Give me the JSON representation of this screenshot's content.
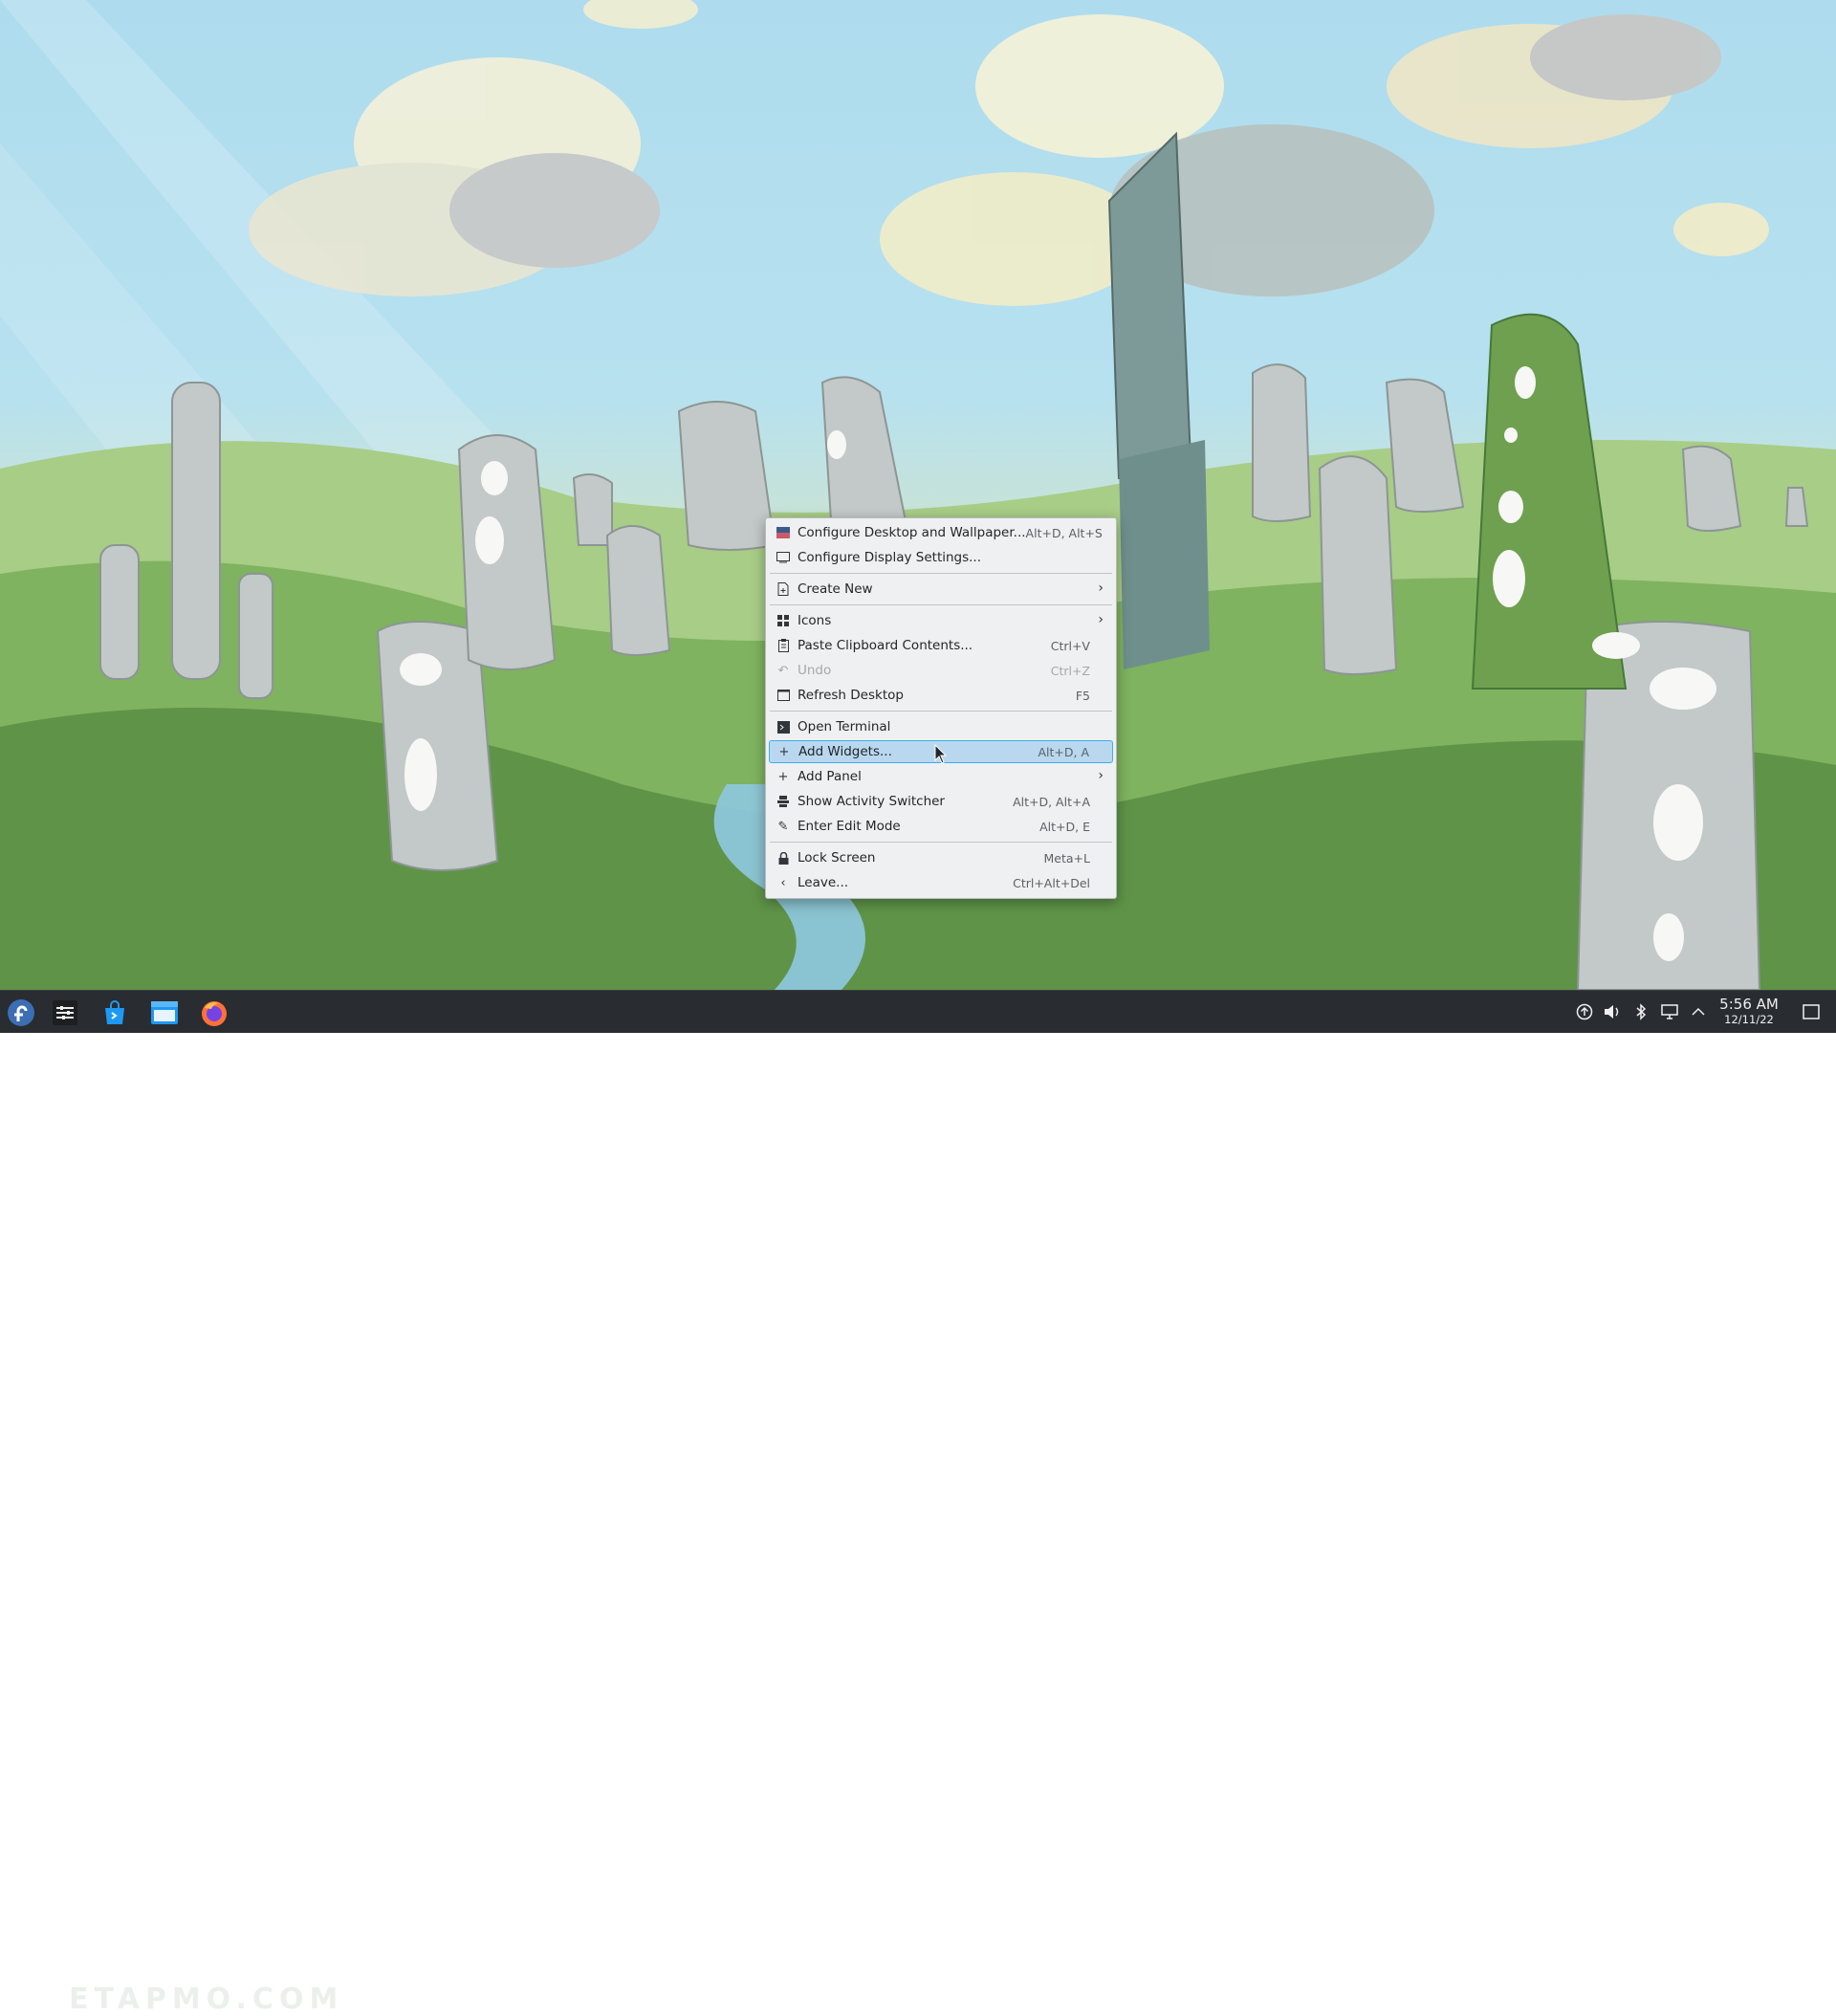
{
  "menu": {
    "items": [
      {
        "icon": "wallpaper-icon",
        "label": "Configure Desktop and Wallpaper...",
        "shortcut": "Alt+D, Alt+S"
      },
      {
        "icon": "display-icon",
        "label": "Configure Display Settings...",
        "shortcut": ""
      },
      {
        "icon": "new-document-icon",
        "label": "Create New",
        "shortcut": ""
      },
      {
        "icon": "icons-grid-icon",
        "label": "Icons",
        "shortcut": ""
      },
      {
        "icon": "clipboard-icon",
        "label": "Paste Clipboard Contents...",
        "shortcut": "Ctrl+V"
      },
      {
        "icon": "undo-icon",
        "label": "Undo",
        "shortcut": "Ctrl+Z"
      },
      {
        "icon": "refresh-icon",
        "label": "Refresh Desktop",
        "shortcut": "F5"
      },
      {
        "icon": "terminal-icon",
        "label": "Open Terminal",
        "shortcut": ""
      },
      {
        "icon": "plus-icon",
        "label": "Add Widgets...",
        "shortcut": "Alt+D, A"
      },
      {
        "icon": "plus-icon",
        "label": "Add Panel",
        "shortcut": ""
      },
      {
        "icon": "activities-icon",
        "label": "Show Activity Switcher",
        "shortcut": "Alt+D, Alt+A"
      },
      {
        "icon": "edit-icon",
        "label": "Enter Edit Mode",
        "shortcut": "Alt+D, E"
      },
      {
        "icon": "lock-icon",
        "label": "Lock Screen",
        "shortcut": "Meta+L"
      },
      {
        "icon": "chevron-left-icon",
        "label": "Leave...",
        "shortcut": "Ctrl+Alt+Del"
      }
    ],
    "hovered_item": "Add Widgets...",
    "disabled_item": "Undo"
  },
  "taskbar": {
    "launchers": [
      "fedora-logo-icon",
      "system-settings-icon",
      "discover-store-icon",
      "dolphin-file-manager-icon",
      "firefox-icon"
    ],
    "tray_icons": [
      "updates-icon",
      "volume-icon",
      "bluetooth-icon",
      "network-icon",
      "expand-tray-icon"
    ],
    "clock": {
      "time": "5:56 AM",
      "date": "12/11/22"
    },
    "watermark": "ETAPMO.COM"
  },
  "colors": {
    "menu_bg": "#eff0f1",
    "highlight": "#b9d8ef",
    "highlight_border": "#3daee9",
    "panel_bg": "#292c30"
  }
}
